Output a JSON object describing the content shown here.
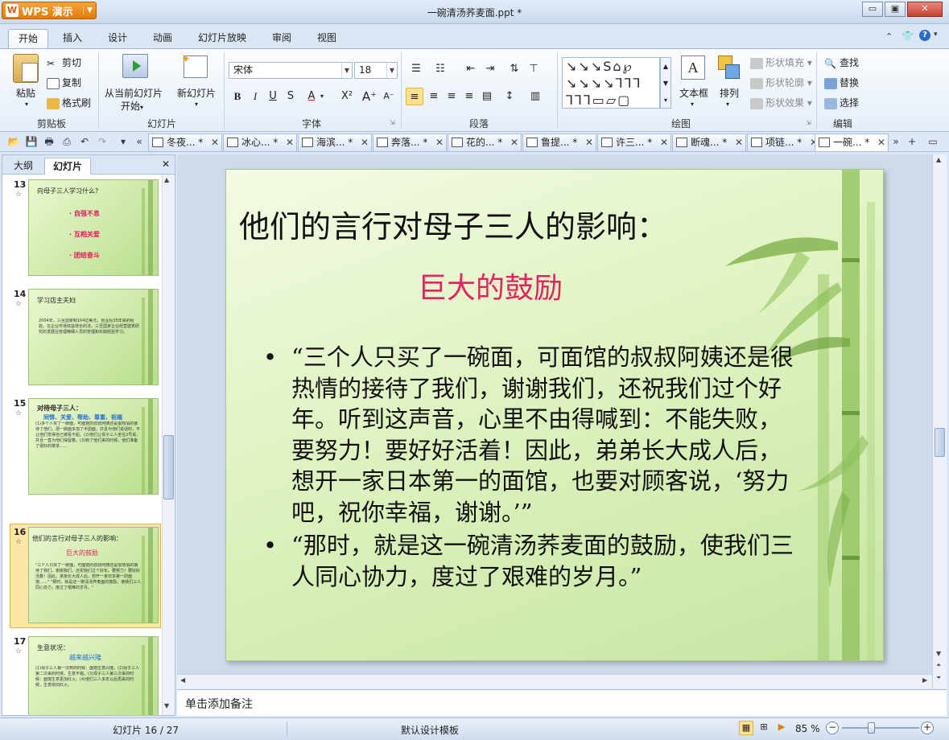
{
  "app": {
    "name": "WPS 演示",
    "logo": "W",
    "doc_title": "一碗清汤荞麦面.ppt *"
  },
  "window": {
    "minimize": "▭",
    "restore": "▣",
    "close": "✕"
  },
  "menu_tabs": [
    "开始",
    "插入",
    "设计",
    "动画",
    "幻灯片放映",
    "审阅",
    "视图"
  ],
  "ribbon": {
    "clipboard": {
      "paste": "粘贴",
      "cut": "剪切",
      "copy": "复制",
      "format_painter": "格式刷",
      "label": "剪贴板"
    },
    "slides": {
      "from_current": "从当前幻灯片",
      "start": "开始",
      "new_slide": "新幻灯片",
      "label": "幻灯片"
    },
    "font": {
      "name": "宋体",
      "size": "18",
      "label": "字体"
    },
    "paragraph": {
      "label": "段落"
    },
    "drawing": {
      "textbox": "文本框",
      "arrange": "排列",
      "shape_fill": "形状填充",
      "shape_outline": "形状轮廓",
      "shape_effect": "形状效果",
      "label": "绘图"
    },
    "edit": {
      "find": "查找",
      "replace": "替换",
      "select": "选择",
      "label": "编辑"
    }
  },
  "doc_tabs": [
    "冬夜...",
    "冰心...",
    "海滨...",
    "奔落...",
    "花的...",
    "鲁提...",
    "许三...",
    "断魂...",
    "项链...",
    "一碗..."
  ],
  "panel": {
    "tab_outline": "大纲",
    "tab_slides": "幻灯片"
  },
  "thumbnails": [
    {
      "num": "13",
      "title": "向母子三人学习什么?",
      "items": [
        "自强不息",
        "互相关爱",
        "团结奋斗"
      ]
    },
    {
      "num": "14",
      "title": "学习店主夫妇",
      "body": "2004年，三至国家制104亿美元，创业后35年来的经验，在企业市场效益增长的法，三至国家企业经营建筑研究的发展业管理精细人员的管理和实践经验学习。"
    },
    {
      "num": "15",
      "title": "对待母子三人：",
      "subtitle": "同情、关爱、帮助、尊重、祝福",
      "body": "(1)多个人买了一碗面，可面馆的叔叔阿姨还是很热情的接待了他们，把一碗面多加了半团面，并且与他们说话时，不让他们觉得自己被看不起。(2)他们让母子三人坐在2号桌，并且一直为他们保留着。(3)到了他们来的时候，他们准备了很好的菜单……"
    },
    {
      "num": "16",
      "title": "他们的言行对母子三人的影响：",
      "subtitle": "巨大的鼓励",
      "body": "\"三个人只买了一碗面，可面馆的叔叔阿姨还是很热情的接待了我们，谢谢我们，还祝我们过个好年。要努力！要好好活着！因此，弟弟长大成人后，想开一家日本第一的面馆……\" \"那时，就是这一碗清汤荞麦面的鼓励，使我们三人同心协力，度过了艰难的岁月。\""
    },
    {
      "num": "17",
      "title": "生意状况：",
      "subtitle": "越来越兴隆",
      "body": "(1)母子三人第一次到的时候：面馆生意兴隆。(2)母子三人第二次来的时候，生意不错。(3)母子三人第三次来的时候：面馆生意更加红火。(4)他们三人多年以后再来的时候，生意依旧红火。"
    }
  ],
  "slide": {
    "title": "他们的言行对母子三人的影响：",
    "subtitle": "巨大的鼓励",
    "bullet_1": [
      "“三个人只买了一碗面，可面馆的叔叔阿姨还是很",
      "热情的接待了我们，谢谢我们，还祝我们过个好",
      "年。听到这声音，心里不由得喊到：不能失败，",
      "要努力！要好好活着！因此，弟弟长大成人后，",
      "想开一家日本第一的面馆，也要对顾客说，‘努力",
      "吧，祝你幸福，谢谢。’”"
    ],
    "bullet_2": [
      "“那时，就是这一碗清汤荞麦面的鼓励，使我们三",
      "人同心协力，度过了艰难的岁月。”"
    ]
  },
  "notes_placeholder": "单击添加备注",
  "status": {
    "slide_counter": "幻灯片 16 / 27",
    "template": "默认设计模板",
    "zoom": "85 %"
  },
  "colors": {
    "accent": "#e0245e",
    "ribbon_bg": "#dbe6f4",
    "slide_bg": "#d8efb6"
  }
}
